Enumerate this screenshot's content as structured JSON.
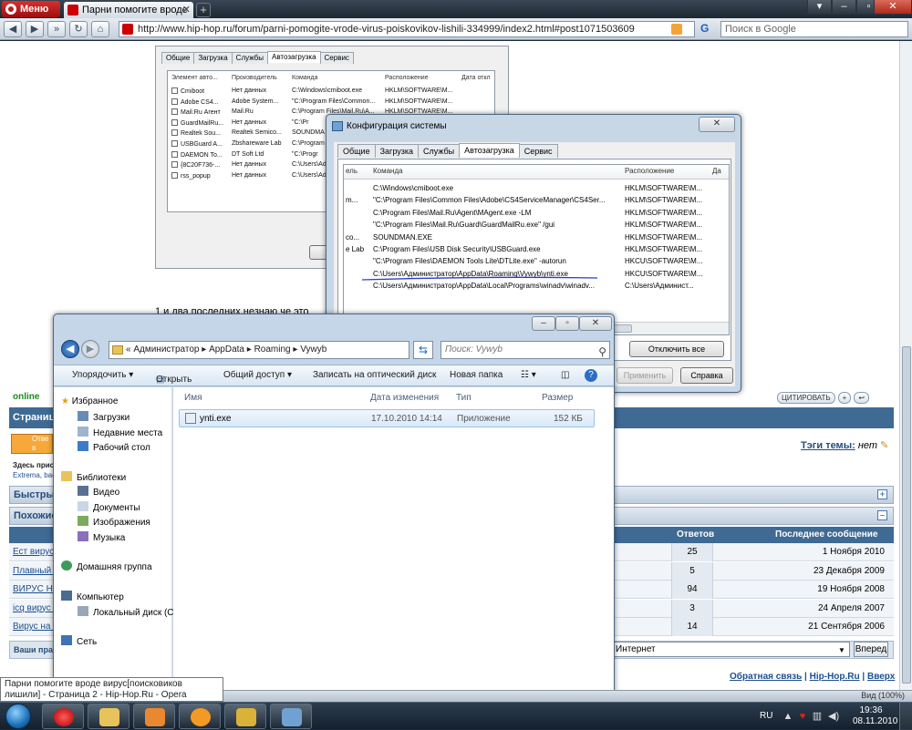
{
  "browser": {
    "menu_label": "Меню",
    "tab_title": "Парни помогите вроде",
    "url": "http://www.hip-hop.ru/forum/parni-pomogite-vrode-virus-poiskovikov-lishili-334999/index2.html#post1071503609",
    "search_placeholder": "Поиск в Google",
    "search_engine_label": "G",
    "zoom": "Вид (100%)"
  },
  "forum": {
    "online": "online",
    "post_text": "1 и два последних,незнаю че это",
    "section_dark": "Страница",
    "answer_label": "Отве в этой",
    "here_present": "Здесь прис",
    "extrema": "Extrema, bac",
    "quick_bar": "Быстрый",
    "similar_bar": "Похожие",
    "tags_label": "Тэги темы:",
    "tags_value": "нет",
    "quote_btn": "ЦИТИРОВАТЬ",
    "similar_cols": {
      "answers": "Ответов",
      "last": "Последнее сообщение"
    },
    "similar_rows": [
      {
        "title": "Ест вирус...",
        "answers": "25",
        "date": "1 Ноября 2010"
      },
      {
        "title": "Плавный -",
        "answers": "5",
        "date": "23 Декабря 2009"
      },
      {
        "title": "ВИРУС НА (",
        "answers": "94",
        "date": "19 Ноября 2008"
      },
      {
        "title": "icq вирус о",
        "answers": "3",
        "date": "24 Апреля 2007"
      },
      {
        "title": "Вирус на хи",
        "answers": "14",
        "date": "21 Сентября 2006"
      }
    ],
    "your_rights": "Ваши пра",
    "language": "Интернет",
    "go_button": "Вперед",
    "footer": {
      "feedback": "Обратная связь",
      "site": "Hip-Hop.Ru",
      "top": "Вверх"
    }
  },
  "back_dialog": {
    "tabs": [
      "Общие",
      "Загрузка",
      "Службы",
      "Автозагрузка",
      "Сервис"
    ],
    "active_tab": 3,
    "headers": [
      "Элемент авто...",
      "Производитель",
      "Команда",
      "Расположение",
      "Дата откл"
    ],
    "rows": [
      [
        "Cmiboot",
        "Нет данных",
        "C:\\Windows\\cmiboot.exe",
        "HKLM\\SOFTWARE\\M..."
      ],
      [
        "Adobe CS4...",
        "Adobe System...",
        "\"C:\\Program Files\\Common...",
        "HKLM\\SOFTWARE\\M..."
      ],
      [
        "Mail.Ru Агент",
        "Mail.Ru",
        "C:\\Program Files\\Mail.Ru\\A...",
        "HKLM\\SOFTWARE\\M..."
      ],
      [
        "GuardMailRu...",
        "Нет данных",
        "\"C:\\Pr",
        "HKLM\\SOFTWARE\\M..."
      ],
      [
        "Realtek Sou...",
        "Realtek Semico...",
        "SOUNDMA",
        ""
      ],
      [
        "USBGuard A...",
        "Zbshareware Lab",
        "C:\\Program",
        ""
      ],
      [
        "DAEMON To...",
        "DT Soft Ltd",
        "\"C:\\Progr",
        ""
      ],
      [
        "{8C20F736-...",
        "Нет данных",
        "C:\\Users\\Ad",
        ""
      ],
      [
        "rss_popup",
        "Нет данных",
        "C:\\Users\\Ad",
        ""
      ]
    ]
  },
  "config_dialog": {
    "title": "Конфигурация системы",
    "close": "✕",
    "tabs": [
      "Общие",
      "Загрузка",
      "Службы",
      "Автозагрузка",
      "Сервис"
    ],
    "active_tab": 3,
    "headers": [
      "ель",
      "Команда",
      "Расположение",
      "Да"
    ],
    "rows": [
      [
        "",
        "C:\\Windows\\cmiboot.exe",
        "HKLM\\SOFTWARE\\M..."
      ],
      [
        "m...",
        "\"C:\\Program Files\\Common Files\\Adobe\\CS4ServiceManager\\CS4Ser...",
        "HKLM\\SOFTWARE\\M..."
      ],
      [
        "",
        "C:\\Program Files\\Mail.Ru\\Agent\\MAgent.exe -LM",
        "HKLM\\SOFTWARE\\M..."
      ],
      [
        "",
        "\"C:\\Program Files\\Mail.Ru\\Guard\\GuardMailRu.exe\" /gui",
        "HKLM\\SOFTWARE\\M..."
      ],
      [
        "co...",
        "SOUNDMAN.EXE",
        "HKLM\\SOFTWARE\\M..."
      ],
      [
        "e Lab",
        "C:\\Program Files\\USB Disk Security\\USBGuard.exe",
        "HKLM\\SOFTWARE\\M..."
      ],
      [
        "",
        "\"C:\\Program Files\\DAEMON Tools Lite\\DTLite.exe\" -autorun",
        "HKCU\\SOFTWARE\\M..."
      ],
      [
        "",
        "C:\\Users\\Администратор\\AppData\\Roaming\\Vywyb\\ynti.exe",
        "HKCU\\SOFTWARE\\M..."
      ],
      [
        "",
        "C:\\Users\\Администратор\\AppData\\Local\\Programs\\winadv\\winadv...",
        "C:\\Users\\Админист..."
      ]
    ],
    "disable_all": "Отключить все",
    "apply": "Применить",
    "help": "Справка"
  },
  "explorer": {
    "path": [
      "«",
      "Администратор",
      "AppData",
      "Roaming",
      "Vywyb"
    ],
    "search_placeholder": "Поиск: Vywyb",
    "toolbar": {
      "organize": "Упорядочить ▾",
      "open": "Открыть",
      "share": "Общий доступ ▾",
      "burn": "Записать на оптический диск",
      "new_folder": "Новая папка"
    },
    "nav": {
      "favorites": "Избранное",
      "downloads": "Загрузки",
      "recent": "Недавние места",
      "desktop": "Рабочий стол",
      "libraries": "Библиотеки",
      "video": "Видео",
      "documents": "Документы",
      "images": "Изображения",
      "music": "Музыка",
      "homegroup": "Домашняя группа",
      "computer": "Компьютер",
      "local_disk": "Локальный диск (C",
      "network": "Сеть"
    },
    "columns": {
      "name": "Имя",
      "date": "Дата изменения",
      "type": "Тип",
      "size": "Размер"
    },
    "file": {
      "name": "ynti.exe",
      "date": "17.10.2010 14:14",
      "type": "Приложение",
      "size": "152 КБ"
    }
  },
  "tooltip": "Парни помогите вроде вирус[поисковиков лишили] - Страница 2 - Hip-Hop.Ru - Opera",
  "taskbar": {
    "lang": "RU",
    "time": "19:36",
    "date": "08.11.2010"
  }
}
